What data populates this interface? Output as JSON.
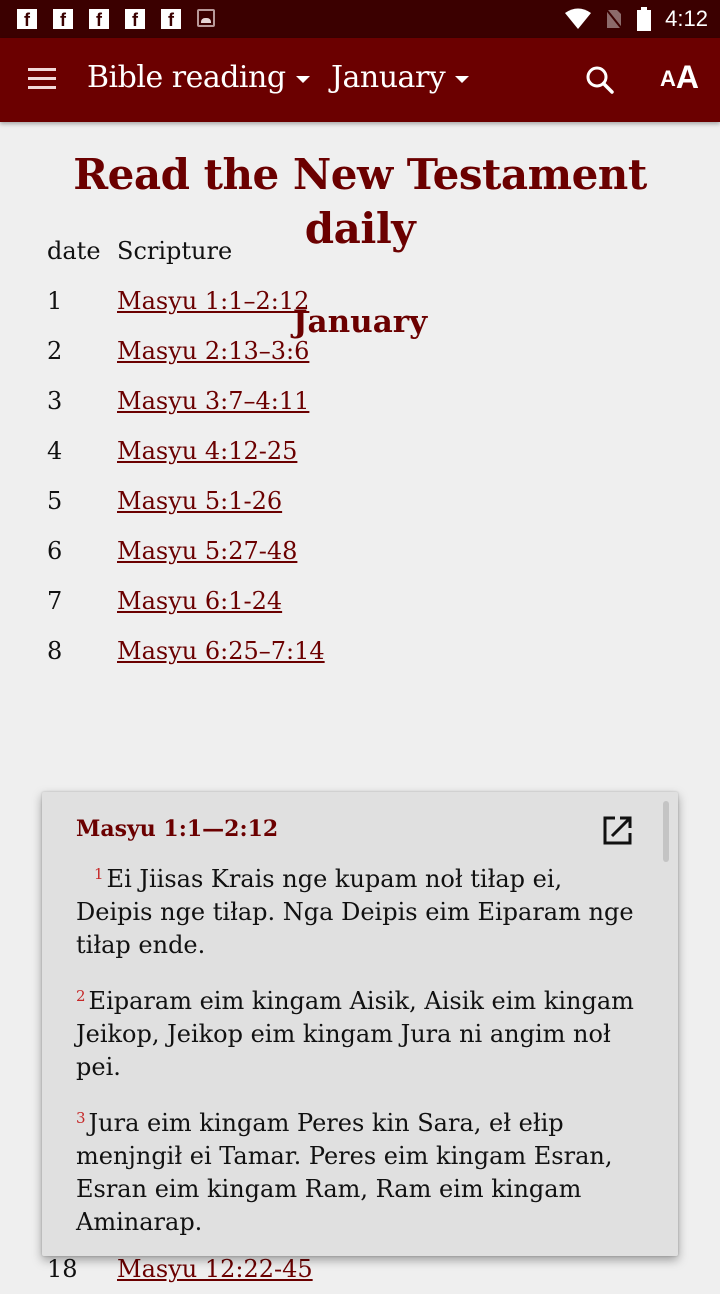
{
  "statusbar": {
    "notification_icons": [
      "facebook-icon",
      "facebook-icon",
      "facebook-icon",
      "facebook-icon",
      "facebook-icon",
      "image-icon"
    ],
    "time": "4:12"
  },
  "appbar": {
    "menu_icon": "hamburger-menu-icon",
    "book_selector": "Bible reading",
    "month_selector": "January",
    "search_icon": "search-icon",
    "text_size_icon": "text-size-icon",
    "aa_small": "A",
    "aa_big": "A"
  },
  "page": {
    "title": "Read the New Testament daily",
    "month": "January",
    "headers": {
      "date": "date",
      "scripture": "Scripture"
    },
    "readings": [
      {
        "date": "1",
        "ref": "Masyu 1:1–2:12"
      },
      {
        "date": "2",
        "ref": "Masyu 2:13–3:6"
      },
      {
        "date": "3",
        "ref": "Masyu 3:7–4:11"
      },
      {
        "date": "4",
        "ref": "Masyu 4:12-25"
      },
      {
        "date": "5",
        "ref": "Masyu 5:1-26"
      },
      {
        "date": "6",
        "ref": "Masyu 5:27-48"
      },
      {
        "date": "7",
        "ref": "Masyu 6:1-24"
      },
      {
        "date": "8",
        "ref": "Masyu 6:25–7:14"
      }
    ],
    "partial_row": {
      "date": "18",
      "ref": "Masyu 12:22-45"
    }
  },
  "popup": {
    "reference": "Masyu 1:1—2:12",
    "open_icon": "open-external-icon",
    "verses": [
      {
        "num": "1",
        "text": "Ei Jiisas Krais nge kupam noł tiłap ei, Deipis nge tiłap. Nga Deipis eim Eiparam nge tiłap ende."
      },
      {
        "num": "2",
        "text": "Eiparam eim kingam Aisik, Aisik eim kingam Jeikop, Jeikop eim kingam Jura ni angim noł pei."
      },
      {
        "num": "3",
        "text": "Jura eim kingam Peres kin Sara, eł ełip menjngił ei Tamar. Peres eim kingam Esran, Esran eim kingam Ram, Ram eim kingam Aminarap."
      }
    ]
  },
  "colors": {
    "primary": "#6b0000",
    "statusbar": "#3b0000",
    "background": "#efefef",
    "verse_number": "#c62828",
    "popup_bg": "#e0e0e0"
  }
}
